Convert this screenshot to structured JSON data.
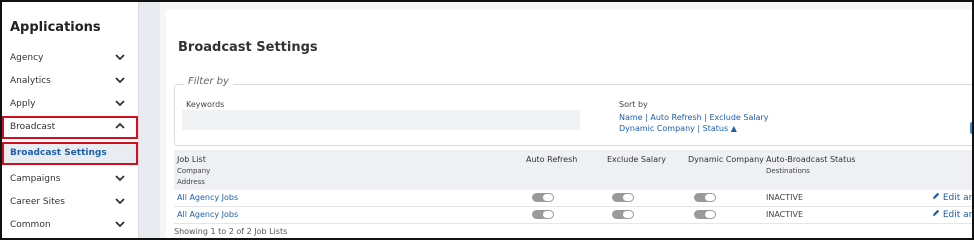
{
  "sidebar": {
    "title": "Applications",
    "items": [
      {
        "label": "Agency",
        "chevron": "down"
      },
      {
        "label": "Analytics",
        "chevron": "down"
      },
      {
        "label": "Apply",
        "chevron": "down"
      },
      {
        "label": "Broadcast",
        "chevron": "up"
      },
      {
        "label": "Broadcast Settings"
      },
      {
        "label": "Campaigns",
        "chevron": "down"
      },
      {
        "label": "Career Sites",
        "chevron": "down"
      },
      {
        "label": "Common",
        "chevron": "down"
      }
    ]
  },
  "main": {
    "title": "Broadcast Settings",
    "filter": {
      "legend": "Filter by",
      "keywords_label": "Keywords",
      "keywords_value": "",
      "sort_label": "Sort by",
      "sort_line1": "Name | Auto Refresh | Exclude Salary",
      "sort_line2": "Dynamic Company | Status ▲"
    },
    "table": {
      "headers": {
        "job_list": "Job List",
        "company": "Company",
        "address": "Address",
        "auto_refresh": "Auto Refresh",
        "exclude_salary": "Exclude Salary",
        "dynamic_company": "Dynamic Company",
        "status": "Auto-Broadcast Status",
        "destinations": "Destinations"
      },
      "rows": [
        {
          "name": "All Agency Jobs",
          "auto_refresh": "off",
          "exclude_salary": "off",
          "dynamic_company": "off",
          "status": "INACTIVE",
          "action": "Edit an"
        },
        {
          "name": "All Agency Jobs",
          "auto_refresh": "off",
          "exclude_salary": "off",
          "dynamic_company": "off",
          "status": "INACTIVE",
          "action": "Edit an"
        }
      ],
      "footer": "Showing 1 to 2 of 2 Job Lists"
    }
  },
  "colors": {
    "link": "#1f5fa8",
    "highlight": "#d0101f",
    "toggle": "#9a9a9a"
  }
}
